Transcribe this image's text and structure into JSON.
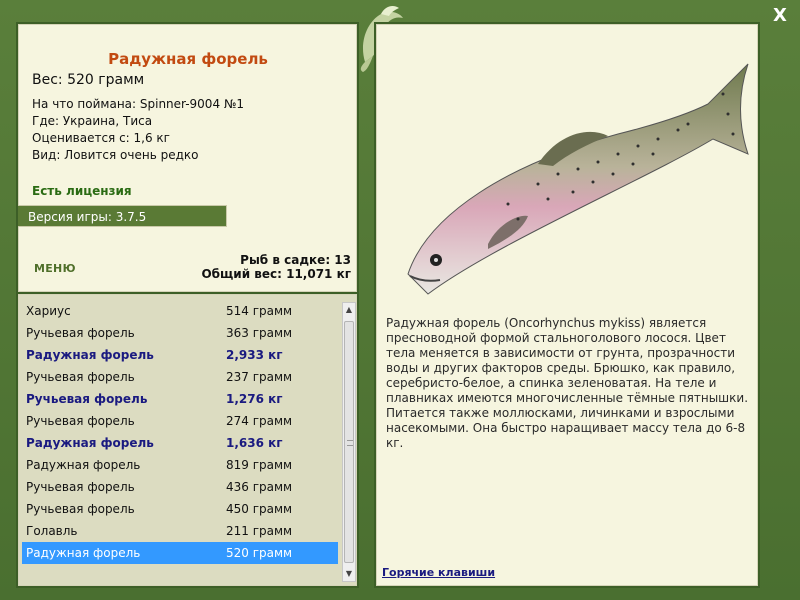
{
  "window": {
    "close_label": "X"
  },
  "fish": {
    "title": "Радужная форель",
    "weight_line": "Вес: 520 грамм",
    "caught_with": "На что поймана: Spinner-9004 №1",
    "where": "Где: Украина, Тиса",
    "estimated": "Оценивается с: 1,6 кг",
    "kind": "Вид: Ловится очень редко"
  },
  "license": "Есть лицензия",
  "version": "Версия игры: 3.7.5",
  "menu_label": "МЕНЮ",
  "stats": {
    "count_line": "Рыб в садке: 13",
    "weight_line": "Общий вес: 11,071 кг"
  },
  "catch_list": [
    {
      "name": "Хариус",
      "weight": "514 грамм",
      "bold": false,
      "selected": false
    },
    {
      "name": "Ручьевая форель",
      "weight": "363 грамм",
      "bold": false,
      "selected": false
    },
    {
      "name": "Радужная форель",
      "weight": "2,933 кг",
      "bold": true,
      "selected": false
    },
    {
      "name": "Ручьевая форель",
      "weight": "237 грамм",
      "bold": false,
      "selected": false
    },
    {
      "name": "Ручьевая форель",
      "weight": "1,276 кг",
      "bold": true,
      "selected": false
    },
    {
      "name": "Ручьевая форель",
      "weight": "274 грамм",
      "bold": false,
      "selected": false
    },
    {
      "name": "Радужная форель",
      "weight": "1,636 кг",
      "bold": true,
      "selected": false
    },
    {
      "name": "Радужная форель",
      "weight": "819 грамм",
      "bold": false,
      "selected": false
    },
    {
      "name": "Ручьевая форель",
      "weight": "436 грамм",
      "bold": false,
      "selected": false
    },
    {
      "name": "Ручьевая форель",
      "weight": "450 грамм",
      "bold": false,
      "selected": false
    },
    {
      "name": "Голавль",
      "weight": "211 грамм",
      "bold": false,
      "selected": false
    },
    {
      "name": "Радужная форель",
      "weight": "520 грамм",
      "bold": false,
      "selected": true
    }
  ],
  "description": "Радужная форель (Oncorhynchus mykiss) является пресноводной формой стальноголового лосося. Цвет тела меняется в зависимости от грунта, прозрачности воды и других факторов среды. Брюшко, как правило, серебристо-белое, а спинка зеленоватая. На теле и плавниках имеются многочисленные тёмные пятнышки. Питается также моллюсками, личинками и взрослыми насекомыми. Она быстро наращивает массу тела до 6-8 кг.",
  "hotkeys_label": "Горячие клавиши",
  "colors": {
    "frame": "#4d7333",
    "panel": "#f6f5df",
    "title": "#c24a11",
    "license": "#2a6b13",
    "selection": "#3399ff",
    "bold_row": "#1a1a80"
  },
  "icons": [
    "close-icon",
    "logo-fish-icon",
    "scroll-up-icon",
    "scroll-down-icon",
    "trout-image"
  ]
}
